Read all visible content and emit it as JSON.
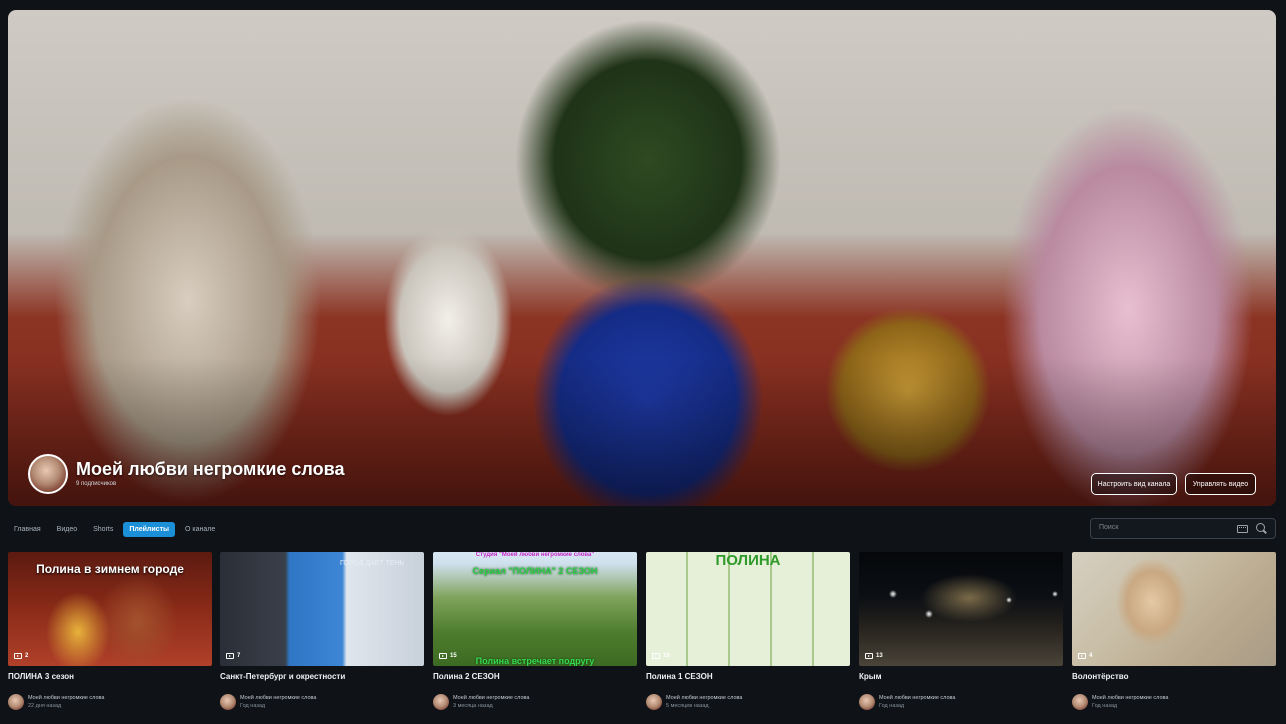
{
  "channel": {
    "name": "Моей любви негромкие слова",
    "subscribers": "9 подписчиков",
    "customize_label": "Настроить вид канала",
    "manage_label": "Управлять видео"
  },
  "tabs": [
    {
      "label": "Главная",
      "active": false
    },
    {
      "label": "Видео",
      "active": false
    },
    {
      "label": "Shorts",
      "active": false
    },
    {
      "label": "Плейлисты",
      "active": true
    },
    {
      "label": "О канале",
      "active": false
    }
  ],
  "search": {
    "placeholder": "Поиск"
  },
  "playlists": [
    {
      "title": "ПОЛИНА 3 сезон",
      "count": "2",
      "owner": "Моей любви негромкие слова",
      "date": "22 дня назад",
      "thumb_text": "Полина в зимнем городе"
    },
    {
      "title": "Санкт-Петербург и окрестности",
      "count": "7",
      "owner": "Моей любви негромкие слова",
      "date": "Год назад",
      "thumb_text": "ГОРОД ДАЕТ ТЕНЬ"
    },
    {
      "title": "Полина 2 СЕЗОН",
      "count": "15",
      "owner": "Моей любви негромкие слова",
      "date": "3 месяца назад",
      "thumb_text": "Сериал \"ПОЛИНА\" 2 СЕЗОН",
      "thumb_top": "Студия \"Моей любви негромкие слова\"",
      "thumb_bottom": "Полина встречает подругу"
    },
    {
      "title": "Полина 1 СЕЗОН",
      "count": "16",
      "owner": "Моей любви негромкие слова",
      "date": "5 месяцев назад",
      "thumb_text": "ПОЛИНА"
    },
    {
      "title": "Крым",
      "count": "13",
      "owner": "Моей любви негромкие слова",
      "date": "Год назад"
    },
    {
      "title": "Волонтёрство",
      "count": "4",
      "owner": "Моей любви негромкие слова",
      "date": "Год назад"
    }
  ]
}
